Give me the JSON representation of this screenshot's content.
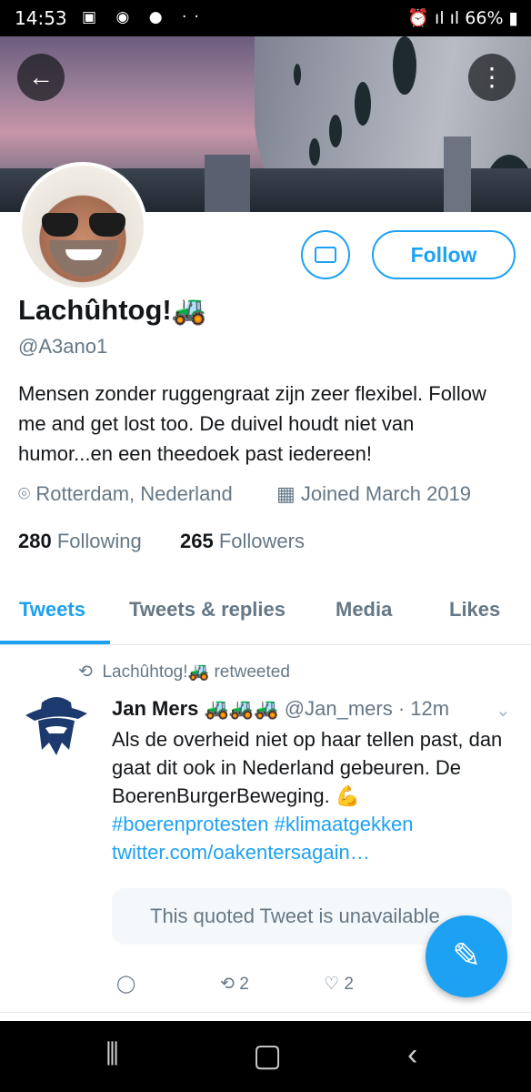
{
  "status_bar": {
    "time": "14:53",
    "battery": "66%"
  },
  "header": {
    "back_icon": "arrow-left-icon",
    "more_icon": "vertical-dots-icon"
  },
  "profile": {
    "name": "Lachûhtog!🚜",
    "handle": "@A3ano1",
    "bio": "Mensen zonder ruggengraat zijn zeer flexibel. Follow me and get lost too. De duivel houdt niet van humor...en een theedoek past iedereen!",
    "location": "Rotterdam, Nederland",
    "joined": "Joined March 2019",
    "following_count": "280",
    "following_label": "Following",
    "followers_count": "265",
    "followers_label": "Followers",
    "follow_label": "Follow"
  },
  "tabs": [
    {
      "label": "Tweets",
      "active": true
    },
    {
      "label": "Tweets & replies"
    },
    {
      "label": "Media"
    },
    {
      "label": "Likes"
    }
  ],
  "tweet": {
    "retweet_line": "Lachûhtog!🚜 retweeted",
    "author_name": "Jan Mers 🚜🚜🚜",
    "author_handle": "@Jan_mers · 12m",
    "text": "Als de overheid niet op haar tellen past, dan gaat dit ook in Nederland gebeuren. De BoerenBurgerBeweging. 💪",
    "hashtags": "#boerenprotesten #klimaatgekken",
    "link": "twitter.com/oakentersagain…",
    "quoted": "This quoted Tweet is unavailable",
    "retweets": "2",
    "likes": "2"
  },
  "colors": {
    "accent": "#1da1f2",
    "muted": "#657786"
  }
}
